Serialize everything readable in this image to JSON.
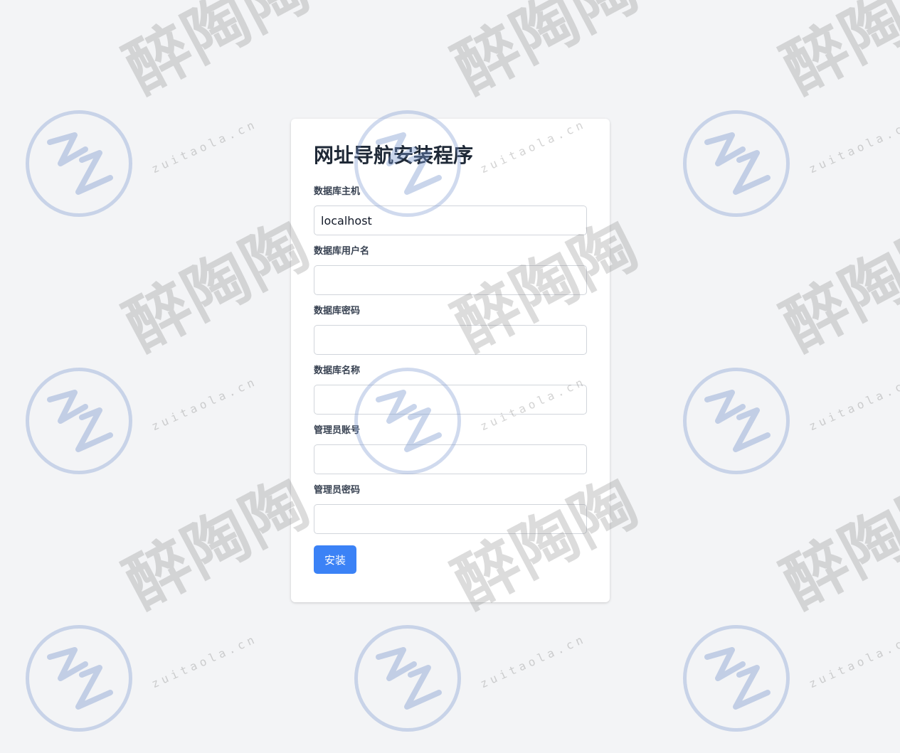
{
  "install": {
    "title": "网址导航安装程序",
    "fields": [
      {
        "label": "数据库主机",
        "value": "localhost",
        "placeholder": ""
      },
      {
        "label": "数据库用户名",
        "value": "",
        "placeholder": ""
      },
      {
        "label": "数据库密码",
        "value": "",
        "placeholder": ""
      },
      {
        "label": "数据库名称",
        "value": "",
        "placeholder": ""
      },
      {
        "label": "管理员账号",
        "value": "",
        "placeholder": ""
      },
      {
        "label": "管理员密码",
        "value": "",
        "placeholder": ""
      }
    ],
    "submit_label": "安装"
  },
  "watermark": {
    "brand": "醉陶陶",
    "domain": "zuitaola.cn",
    "color": "#7896cd"
  },
  "colors": {
    "background": "#f3f4f6",
    "accent": "#3b82f6",
    "card": "#ffffff"
  }
}
